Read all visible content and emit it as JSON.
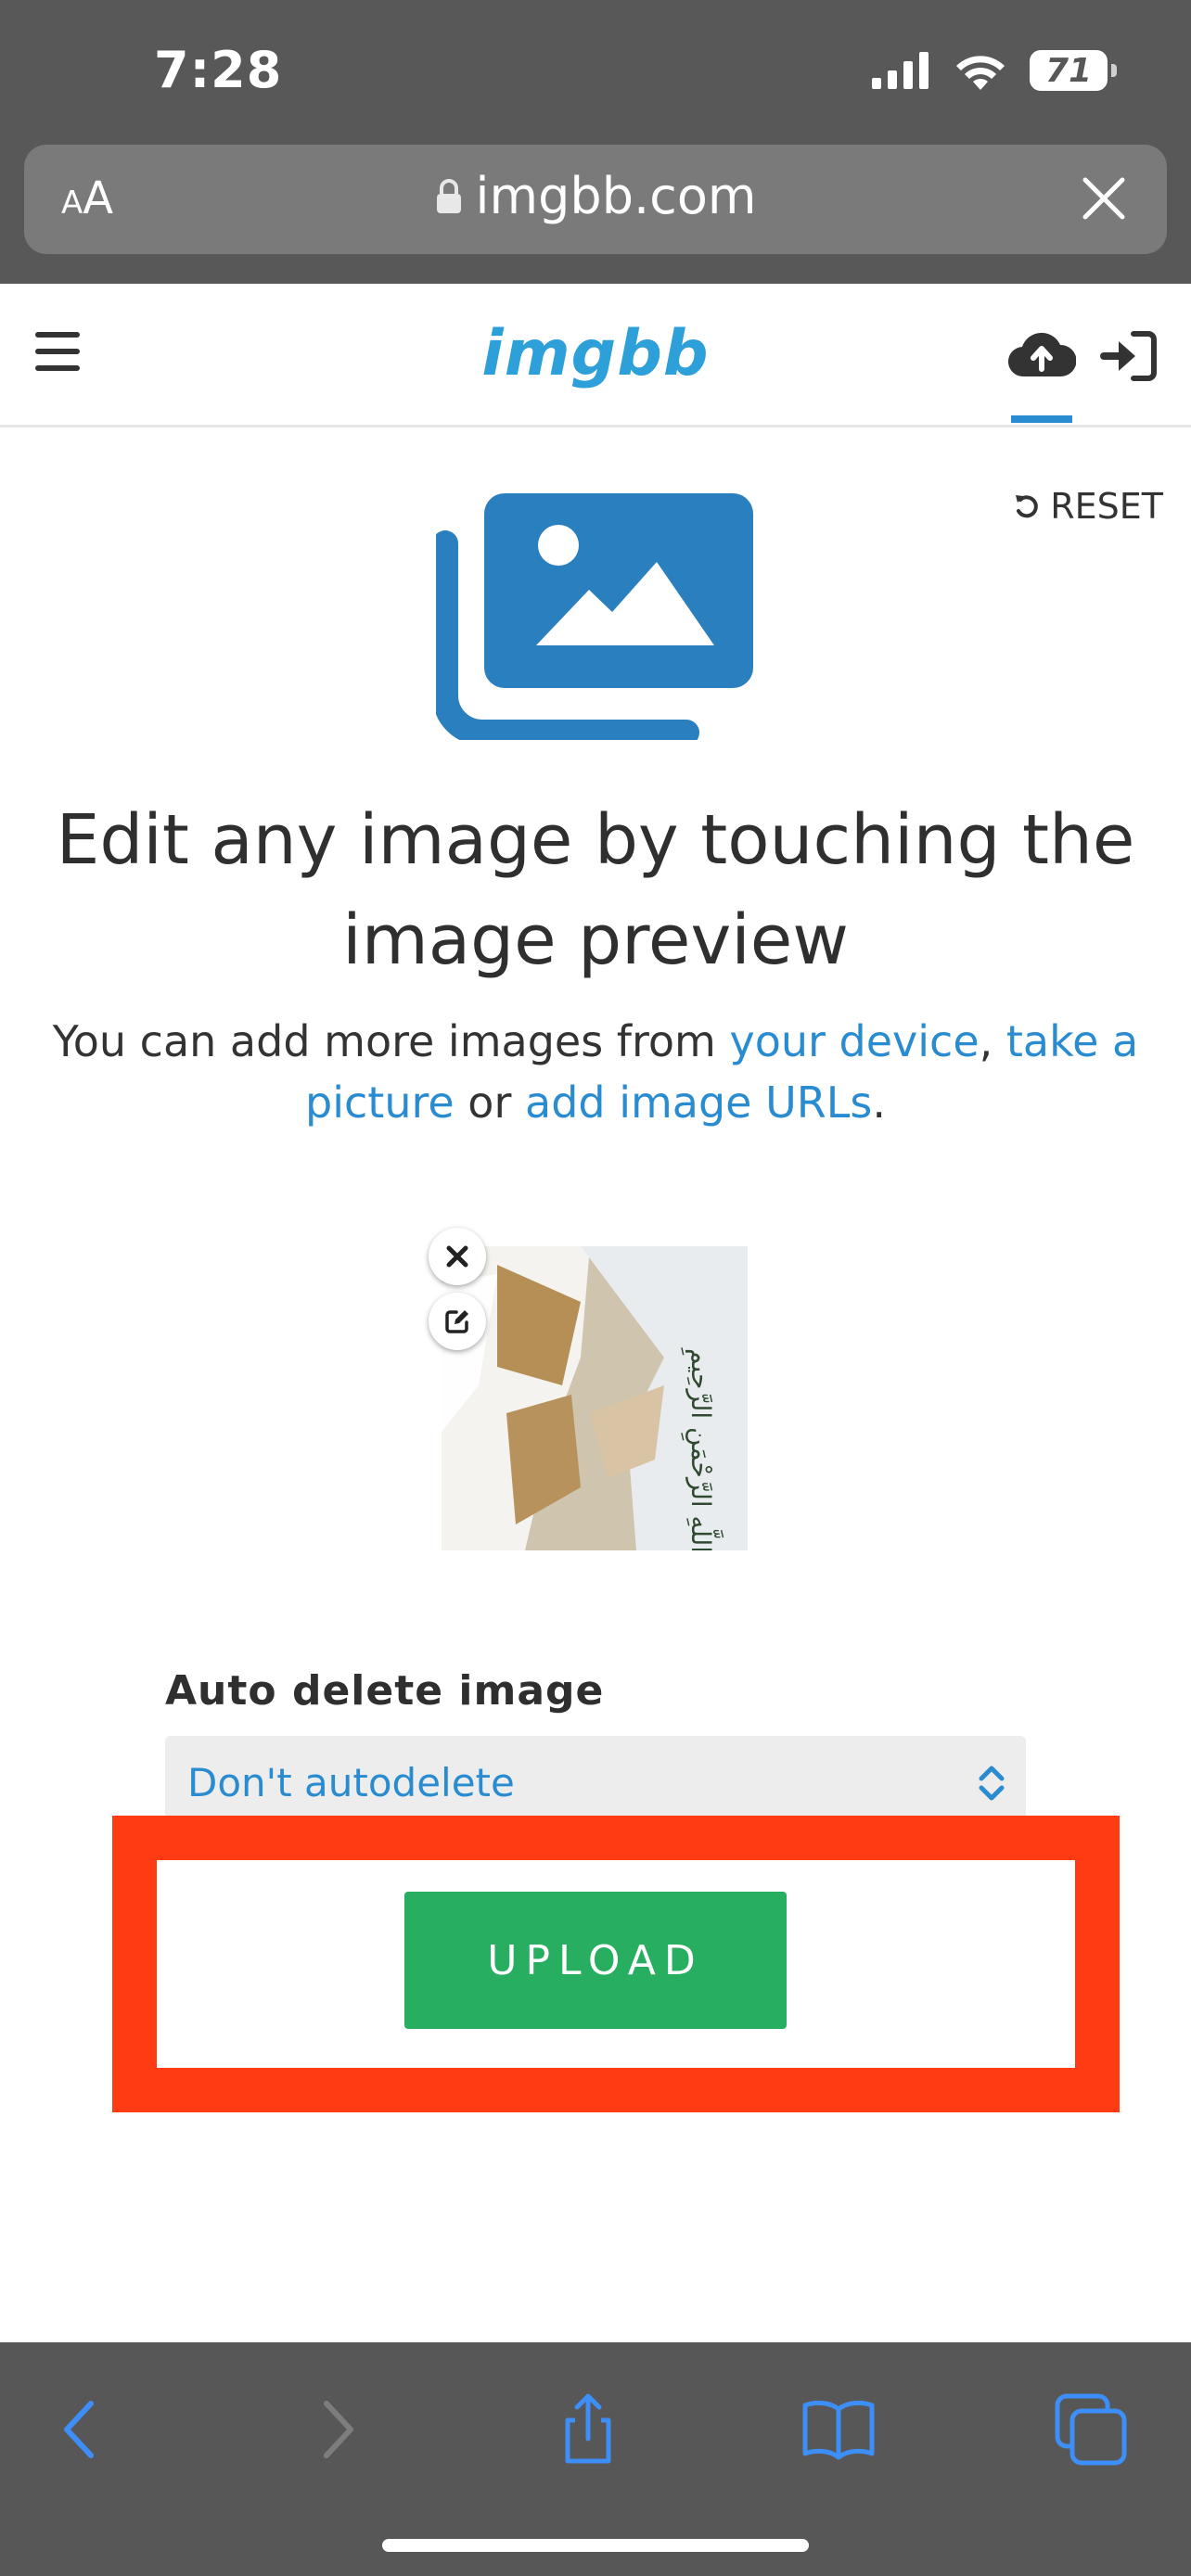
{
  "status_bar": {
    "time": "7:28",
    "battery": "71"
  },
  "browser": {
    "text_size_small": "A",
    "text_size_large": "A",
    "url": "imgbb.com"
  },
  "site": {
    "logo": "imgbb"
  },
  "main": {
    "reset_label": "RESET",
    "headline": "Edit any image by touching the image preview",
    "subline": {
      "prefix": "You can add more images from ",
      "link_device": "your device",
      "sep1": ", ",
      "link_camera": "take a picture",
      "sep2": " or ",
      "link_urls": "add image URLs",
      "suffix": "."
    },
    "thumbnail": {
      "arabic_text": "بِسْمِ اللَّهِ الرَّحْمَنِ الرَّحِيمِ"
    },
    "auto_delete": {
      "label": "Auto delete image",
      "selected": "Don't autodelete"
    },
    "upload_label": "UPLOAD"
  },
  "colors": {
    "accent_blue": "#2a8cd0",
    "upload_green": "#27ae60",
    "highlight_red": "#ff3b14"
  }
}
